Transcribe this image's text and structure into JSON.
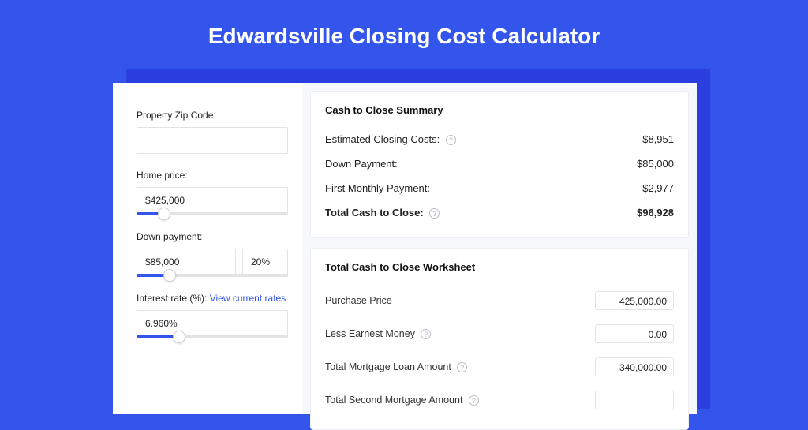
{
  "title": "Edwardsville Closing Cost Calculator",
  "colors": {
    "brand": "#3455eb"
  },
  "inputs": {
    "zip": {
      "label": "Property Zip Code:",
      "value": ""
    },
    "home_price": {
      "label": "Home price:",
      "value": "$425,000",
      "slider_pct": 18
    },
    "down_payment": {
      "label": "Down payment:",
      "value": "$85,000",
      "pct": "20%",
      "slider_pct": 22
    },
    "interest_rate": {
      "label": "Interest rate (%):",
      "link": "View current rates",
      "value": "6.960%",
      "slider_pct": 28
    }
  },
  "summary": {
    "heading": "Cash to Close Summary",
    "rows": [
      {
        "label": "Estimated Closing Costs:",
        "help": true,
        "value": "$8,951"
      },
      {
        "label": "Down Payment:",
        "help": false,
        "value": "$85,000"
      },
      {
        "label": "First Monthly Payment:",
        "help": false,
        "value": "$2,977"
      }
    ],
    "total": {
      "label": "Total Cash to Close:",
      "help": true,
      "value": "$96,928"
    }
  },
  "worksheet": {
    "heading": "Total Cash to Close Worksheet",
    "rows": [
      {
        "label": "Purchase Price",
        "help": false,
        "value": "425,000.00"
      },
      {
        "label": "Less Earnest Money",
        "help": true,
        "value": "0.00"
      },
      {
        "label": "Total Mortgage Loan Amount",
        "help": true,
        "value": "340,000.00"
      },
      {
        "label": "Total Second Mortgage Amount",
        "help": true,
        "value": ""
      }
    ]
  }
}
